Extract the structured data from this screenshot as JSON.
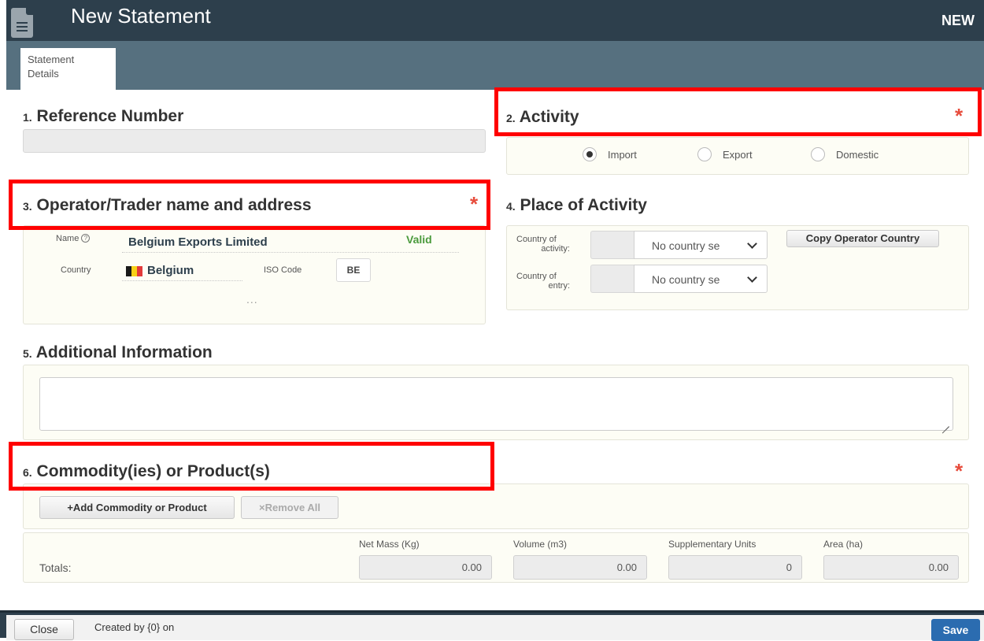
{
  "header": {
    "title": "New Statement",
    "status": "NEW",
    "icon": "document-icon"
  },
  "tabs": [
    {
      "label_line1": "Statement",
      "label_line2": "Details"
    }
  ],
  "sections": {
    "reference": {
      "num": "1.",
      "title": "Reference Number",
      "value": ""
    },
    "activity": {
      "num": "2.",
      "title": "Activity",
      "required": "*",
      "options": [
        "Import",
        "Export",
        "Domestic"
      ],
      "selected": "Import"
    },
    "operator": {
      "num": "3.",
      "title": "Operator/Trader name and address",
      "required": "*",
      "name_label": "Name",
      "name_value": "Belgium Exports Limited",
      "status": "Valid",
      "country_label": "Country",
      "country_value": "Belgium",
      "iso_label": "ISO Code",
      "iso_value": "BE",
      "more": "..."
    },
    "place": {
      "num": "4.",
      "title": "Place of Activity",
      "activity_label_1": "Country of",
      "activity_label_2": "activity:",
      "entry_label_1": "Country of",
      "entry_label_2": "entry:",
      "activity_select": "No country se",
      "entry_select": "No country se",
      "copy_button": "Copy Operator Country"
    },
    "additional": {
      "num": "5.",
      "title": "Additional Information",
      "value": ""
    },
    "commodity": {
      "num": "6.",
      "title": "Commodity(ies) or Product(s)",
      "required": "*",
      "add_button": "+Add Commodity or Product",
      "remove_button": "×Remove All"
    }
  },
  "totals": {
    "label": "Totals:",
    "headers": [
      "Net Mass (Kg)",
      "Volume (m3)",
      "Supplementary Units",
      "Area (ha)"
    ],
    "values": [
      "0.00",
      "0.00",
      "0",
      "0.00"
    ]
  },
  "footer": {
    "close": "Close",
    "created_by": "Created by {0} on",
    "save": "Save"
  },
  "colors": {
    "header": "#2d3f4c",
    "tabbar": "#56707f",
    "required": "#e74c3c",
    "highlight": "#ff0000",
    "save": "#2b6cb0",
    "valid": "#4a9a3c"
  }
}
